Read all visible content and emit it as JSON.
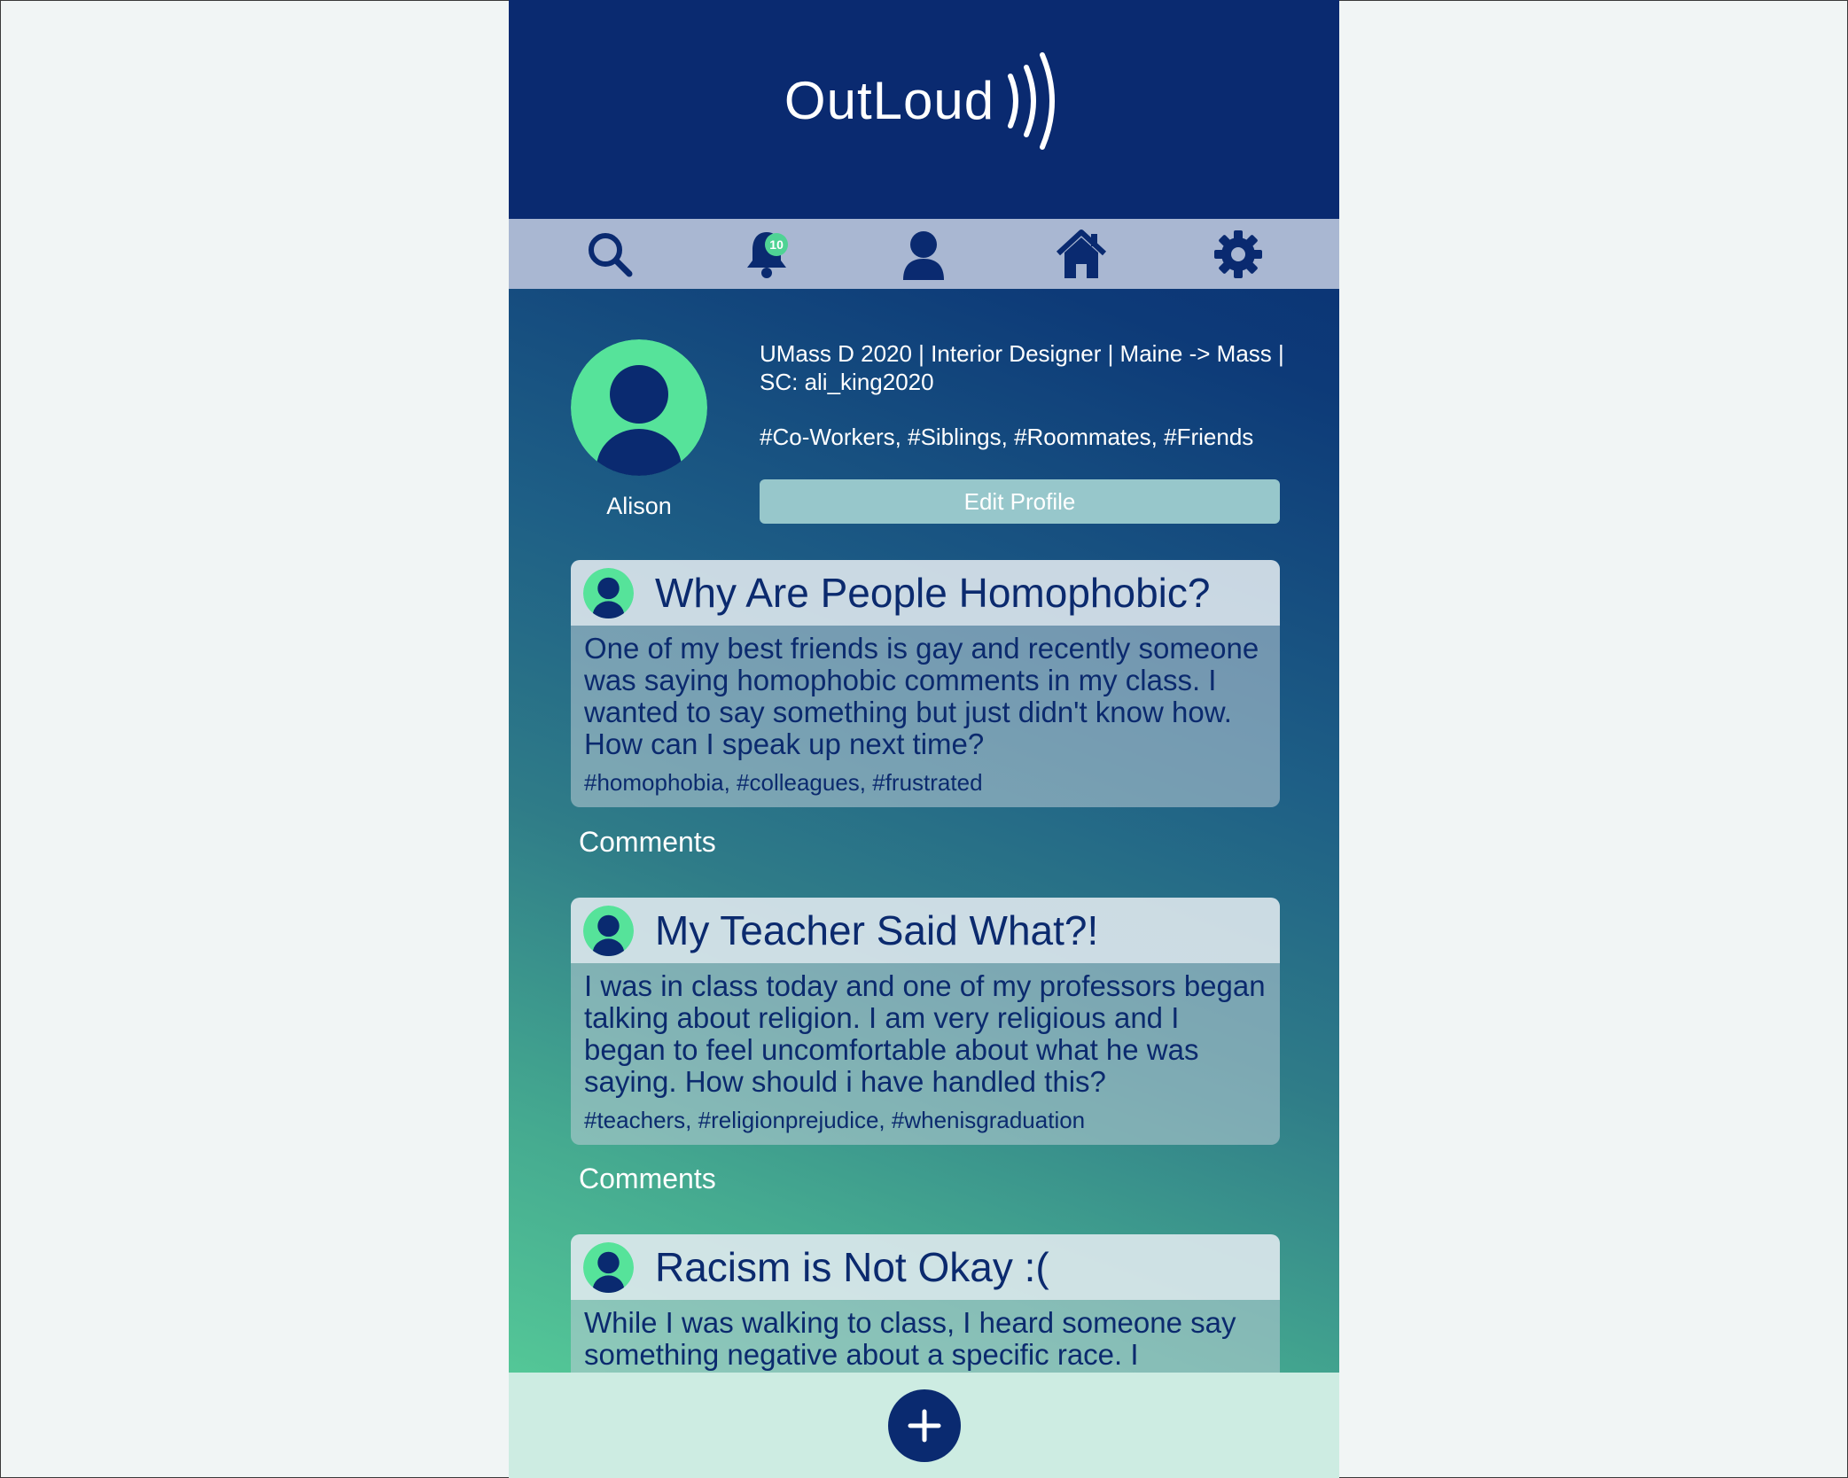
{
  "app": {
    "logo_text": "OutLoud"
  },
  "nav": {
    "items": [
      {
        "name": "search",
        "icon": "search-icon"
      },
      {
        "name": "notifications",
        "icon": "bell-icon",
        "badge": "10"
      },
      {
        "name": "profile",
        "icon": "user-icon"
      },
      {
        "name": "home",
        "icon": "home-icon"
      },
      {
        "name": "settings",
        "icon": "gear-icon"
      }
    ]
  },
  "profile": {
    "name": "Alison",
    "bio": "UMass D 2020 | Interior Designer | Maine -> Mass | SC: ali_king2020",
    "tags": "#Co-Workers, #Siblings, #Roommates, #Friends",
    "edit_label": "Edit Profile"
  },
  "posts": [
    {
      "title": "Why Are People Homophobic?",
      "body": "One of my best friends is gay and recently someone was saying homophobic comments in my class. I wanted to say something but just didn't know how. How can I speak up next time?",
      "tags": "#homophobia, #colleagues, #frustrated",
      "comments_label": "Comments"
    },
    {
      "title": "My Teacher Said What?!",
      "body": "I was in class today and one of my professors began talking about religion. I am very religious and I began to feel uncomfortable about what he was saying. How should i have handled this?",
      "tags": "#teachers, #religionprejudice, #whenisgraduation",
      "comments_label": "Comments"
    },
    {
      "title": "Racism is Not Okay :(",
      "body": "While I was walking to class, I heard someone say something negative about a specific race. I"
    }
  ],
  "colors": {
    "navy": "#0a2a70",
    "accent_green": "#4fd394",
    "nav_bar": "#a9b7d2",
    "button_teal": "#97c7cb",
    "footer": "#cdece2"
  },
  "footer": {
    "add_icon": "plus-icon"
  }
}
